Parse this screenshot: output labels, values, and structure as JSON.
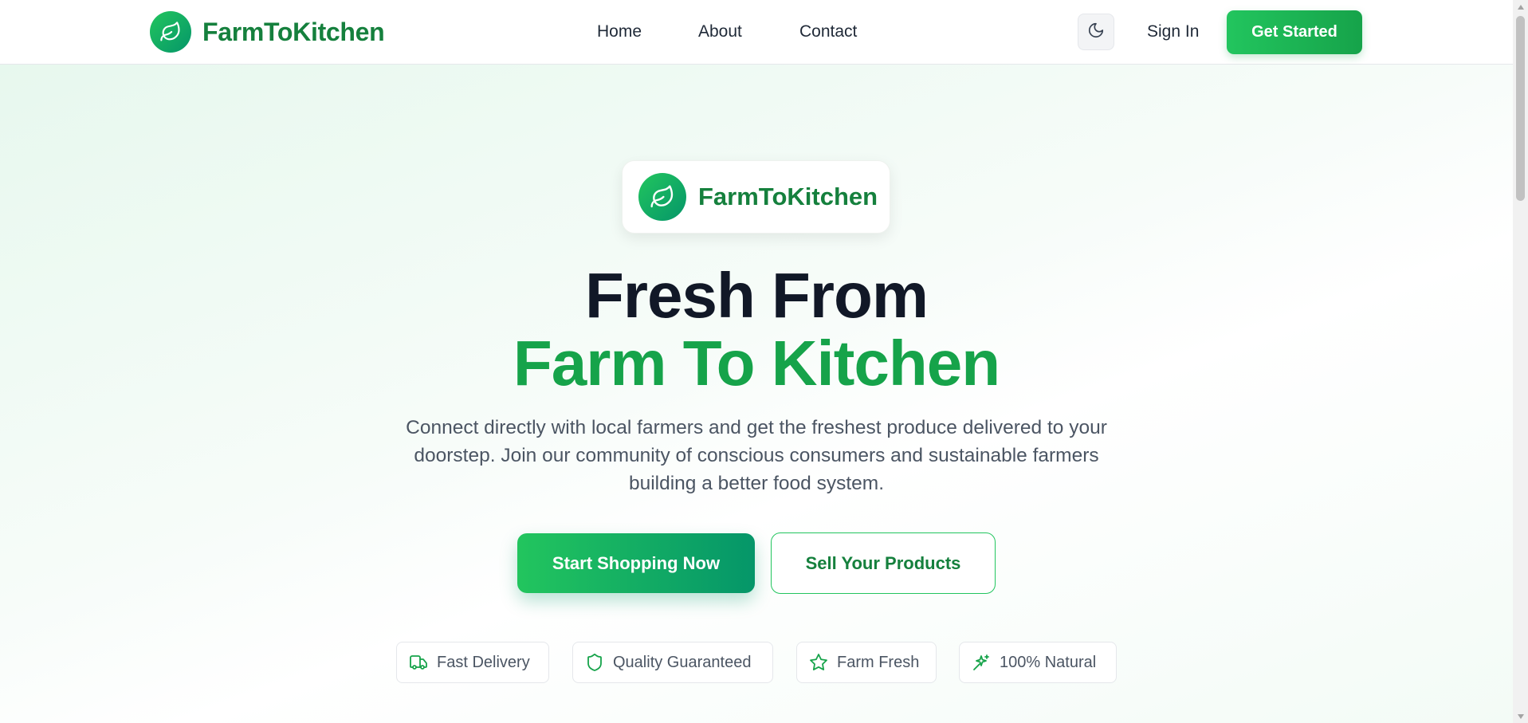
{
  "header": {
    "brand": "FarmToKitchen",
    "nav": [
      "Home",
      "About",
      "Contact"
    ],
    "sign_in": "Sign In",
    "get_started": "Get Started"
  },
  "hero": {
    "badge_text": "FarmToKitchen",
    "headline_line1": "Fresh From",
    "headline_line2": "Farm To Kitchen",
    "subtext": "Connect directly with local farmers and get the freshest produce delivered to your doorstep. Join our community of conscious consumers and sustainable farmers building a better food system.",
    "primary_cta": "Start Shopping Now",
    "secondary_cta": "Sell Your Products",
    "features": [
      {
        "label": "Fast Delivery",
        "icon": "truck-icon"
      },
      {
        "label": "Quality Guaranteed",
        "icon": "shield-icon"
      },
      {
        "label": "Farm Fresh",
        "icon": "star-icon"
      },
      {
        "label": "100% Natural",
        "icon": "sparkles-icon"
      }
    ]
  },
  "colors": {
    "brand_green": "#16a34a",
    "dark_text": "#111827",
    "gradient_start": "#22c55e",
    "gradient_end": "#059669"
  }
}
